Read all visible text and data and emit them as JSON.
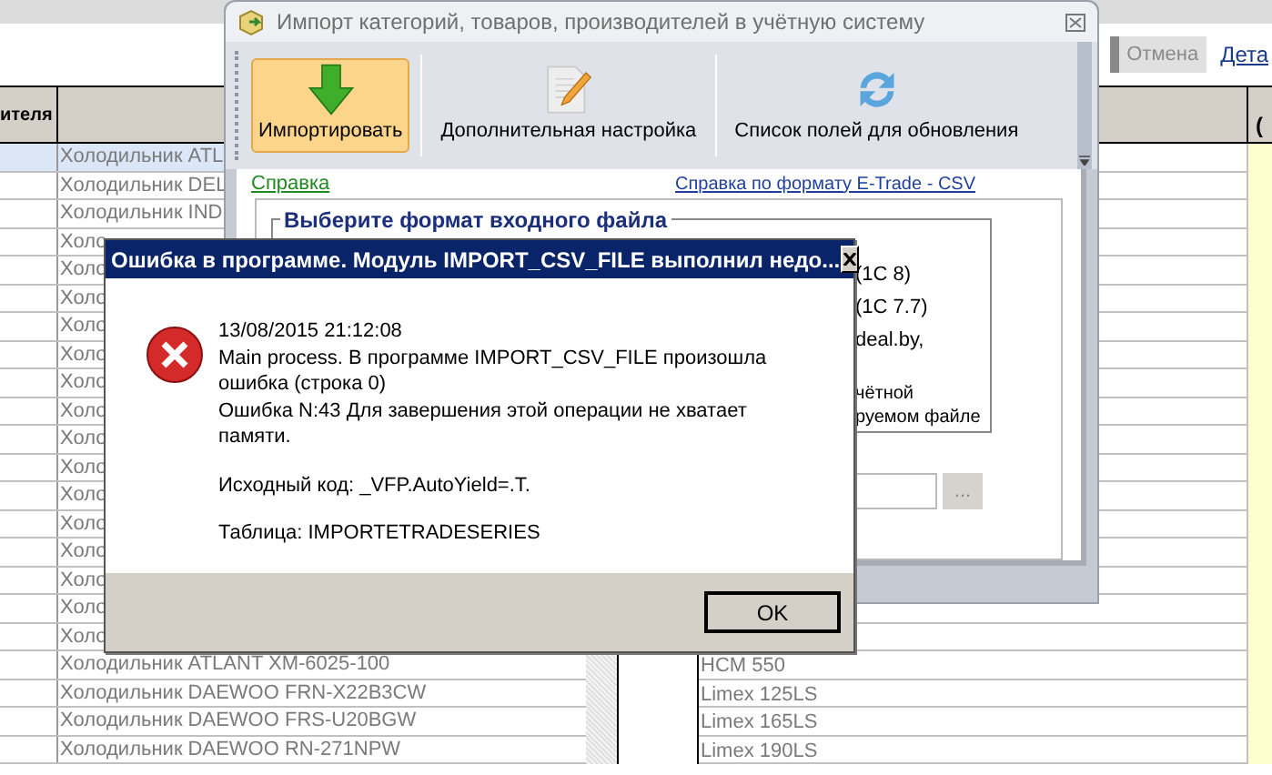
{
  "background_app": {
    "cancel_button": {
      "label": "Отмена",
      "disabled": true
    },
    "details_link": "Дета",
    "left_grid": {
      "column_1_header": "ителя",
      "rows": [
        {
          "text": "Холодильник ATL",
          "selected": true
        },
        {
          "text": "Холодильник DEL",
          "selected": false
        },
        {
          "text": "Холодильник IND",
          "selected": false
        },
        {
          "text": "Холо",
          "selected": false
        },
        {
          "text": "Холо",
          "selected": false
        },
        {
          "text": "Холо",
          "selected": false
        },
        {
          "text": "Холо",
          "selected": false
        },
        {
          "text": "Холо",
          "selected": false
        },
        {
          "text": "Холо",
          "selected": false
        },
        {
          "text": "Холо",
          "selected": false
        },
        {
          "text": "Холо",
          "selected": false
        },
        {
          "text": "Холо",
          "selected": false
        },
        {
          "text": "Холо",
          "selected": false
        },
        {
          "text": "Холо",
          "selected": false
        },
        {
          "text": "Холо",
          "selected": false
        },
        {
          "text": "Холо",
          "selected": false
        },
        {
          "text": "Холо",
          "selected": false
        },
        {
          "text": "Холо",
          "selected": false
        },
        {
          "text": "Холодильник ATLANT XM-6025-100",
          "selected": false
        },
        {
          "text": "Холодильник DAEWOO FRN-X22B3CW",
          "selected": false
        },
        {
          "text": "Холодильник DAEWOO FRS-U20BGW",
          "selected": false
        },
        {
          "text": "Холодильник DAEWOO RN-271NPW",
          "selected": false
        }
      ]
    },
    "right_grid": {
      "column_2_header": "(",
      "rows": [
        "HCM 550",
        "Limex 125LS",
        "Limex 165LS",
        "Limex 190LS"
      ]
    }
  },
  "import_window": {
    "title": "Импорт категорий, товаров, производителей в учётную систему",
    "toolbar": [
      {
        "label": "Импортировать",
        "kind": "import",
        "selected": true
      },
      {
        "label": "Дополнительная настройка",
        "kind": "settings",
        "selected": false
      },
      {
        "label": "Список полей для обновления",
        "kind": "refresh",
        "selected": false
      }
    ],
    "help_link": "Справка",
    "format_help_link": "Справка по формату E-Trade - CSV",
    "format_group": {
      "title": "Выберите формат входного файла",
      "options": [
        {
          "text": "(1С 8)",
          "kind": "line"
        },
        {
          "text": "(1С 7.7)",
          "kind": "line"
        },
        {
          "text": "deal.by,",
          "kind": "line"
        },
        {
          "text": "чётной",
          "kind": "note"
        },
        {
          "text": "руемом файле",
          "kind": "note"
        }
      ]
    },
    "browse_button": "..."
  },
  "error_dialog": {
    "title": "Ошибка в программе. Модуль IMPORT_CSV_FILE выполнил недо...",
    "message": [
      "13/08/2015 21:12:08\nMain process. В программе IMPORT_CSV_FILE произошла ошибка (строка 0)\nОшибка N:43 Для завершения этой операции не хватает памяти.",
      "Исходный код: _VFP.AutoYield=.T.",
      "Таблица: IMPORTETRADESERIES"
    ],
    "ok_button": "OK"
  }
}
